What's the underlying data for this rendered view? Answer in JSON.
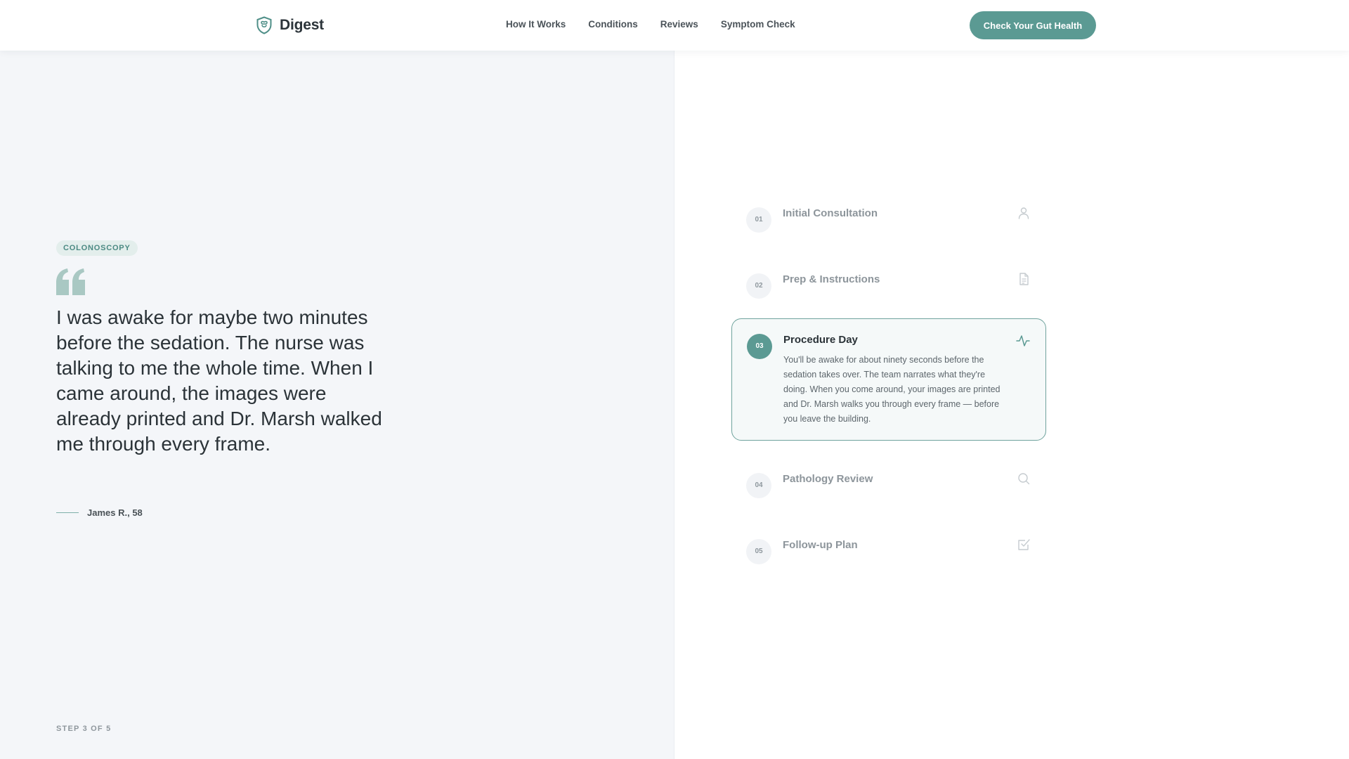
{
  "header": {
    "logo_text": "Digest",
    "nav": [
      "How It Works",
      "Conditions",
      "Reviews",
      "Symptom Check"
    ],
    "cta_label": "Check Your Gut Health"
  },
  "testimonial": {
    "tag": "COLONOSCOPY",
    "quote": "I was awake for maybe two minutes before the sedation. The nurse was talking to me the whole time. When I came around, the images were already printed and Dr. Marsh walked me through every frame.",
    "author": "James R., 58",
    "step_indicator": "STEP 3 OF 5"
  },
  "steps": [
    {
      "number": "01",
      "title": "Initial Consultation",
      "icon": "user-icon",
      "active": false
    },
    {
      "number": "02",
      "title": "Prep & Instructions",
      "icon": "document-icon",
      "active": false
    },
    {
      "number": "03",
      "title": "Procedure Day",
      "icon": "activity-icon",
      "active": true,
      "description": "You'll be awake for about ninety seconds before the sedation takes over. The team narrates what they're doing. When you come around, your images are printed and Dr. Marsh walks you through every frame — before you leave the building."
    },
    {
      "number": "04",
      "title": "Pathology Review",
      "icon": "search-icon",
      "active": false
    },
    {
      "number": "05",
      "title": "Follow-up Plan",
      "icon": "check-square-icon",
      "active": false
    }
  ],
  "colors": {
    "accent": "#5b9a93",
    "left_panel_bg": "#f4f6f9",
    "active_border": "#6fa39d"
  }
}
